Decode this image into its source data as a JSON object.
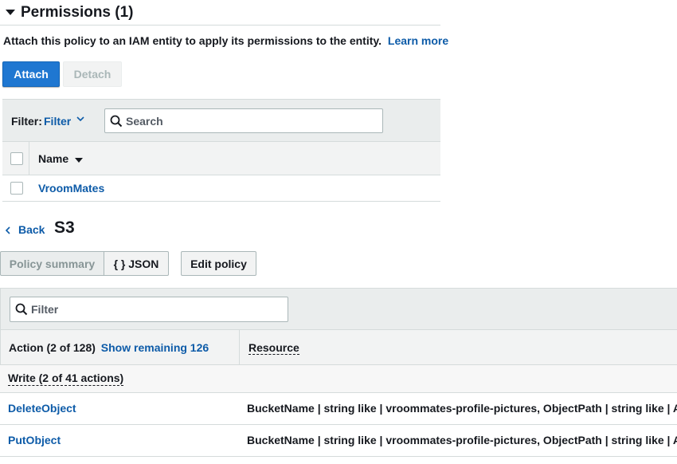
{
  "permissions": {
    "title": "Permissions (1)",
    "description": "Attach this policy to an IAM entity to apply its permissions to the entity.",
    "learn_more": "Learn more",
    "attach_label": "Attach",
    "detach_label": "Detach",
    "filter_label": "Filter:",
    "filter_value": "Filter",
    "search_placeholder": "Search",
    "column_name": "Name",
    "rows": [
      {
        "name": "VroomMates"
      }
    ]
  },
  "nav": {
    "back_label": "Back",
    "service_title": "S3"
  },
  "view_toggle": {
    "summary_label": "Policy summary",
    "json_label": "{ } JSON",
    "edit_label": "Edit policy"
  },
  "policy_table": {
    "filter_placeholder": "Filter",
    "action_header": "Action (2 of 128)",
    "show_remaining": "Show remaining 126",
    "resource_header": "Resource",
    "group_label": "Write (2 of 41 actions)",
    "rows": [
      {
        "action": "DeleteObject",
        "resource": "BucketName | string like | vroommates-profile-pictures, ObjectPath | string like | All"
      },
      {
        "action": "PutObject",
        "resource": "BucketName | string like | vroommates-profile-pictures, ObjectPath | string like | All"
      }
    ]
  },
  "colors": {
    "primary": "#1f77d1",
    "link": "#0d5ba8",
    "header_bg": "#eaeded",
    "border": "#d5dbdb"
  }
}
